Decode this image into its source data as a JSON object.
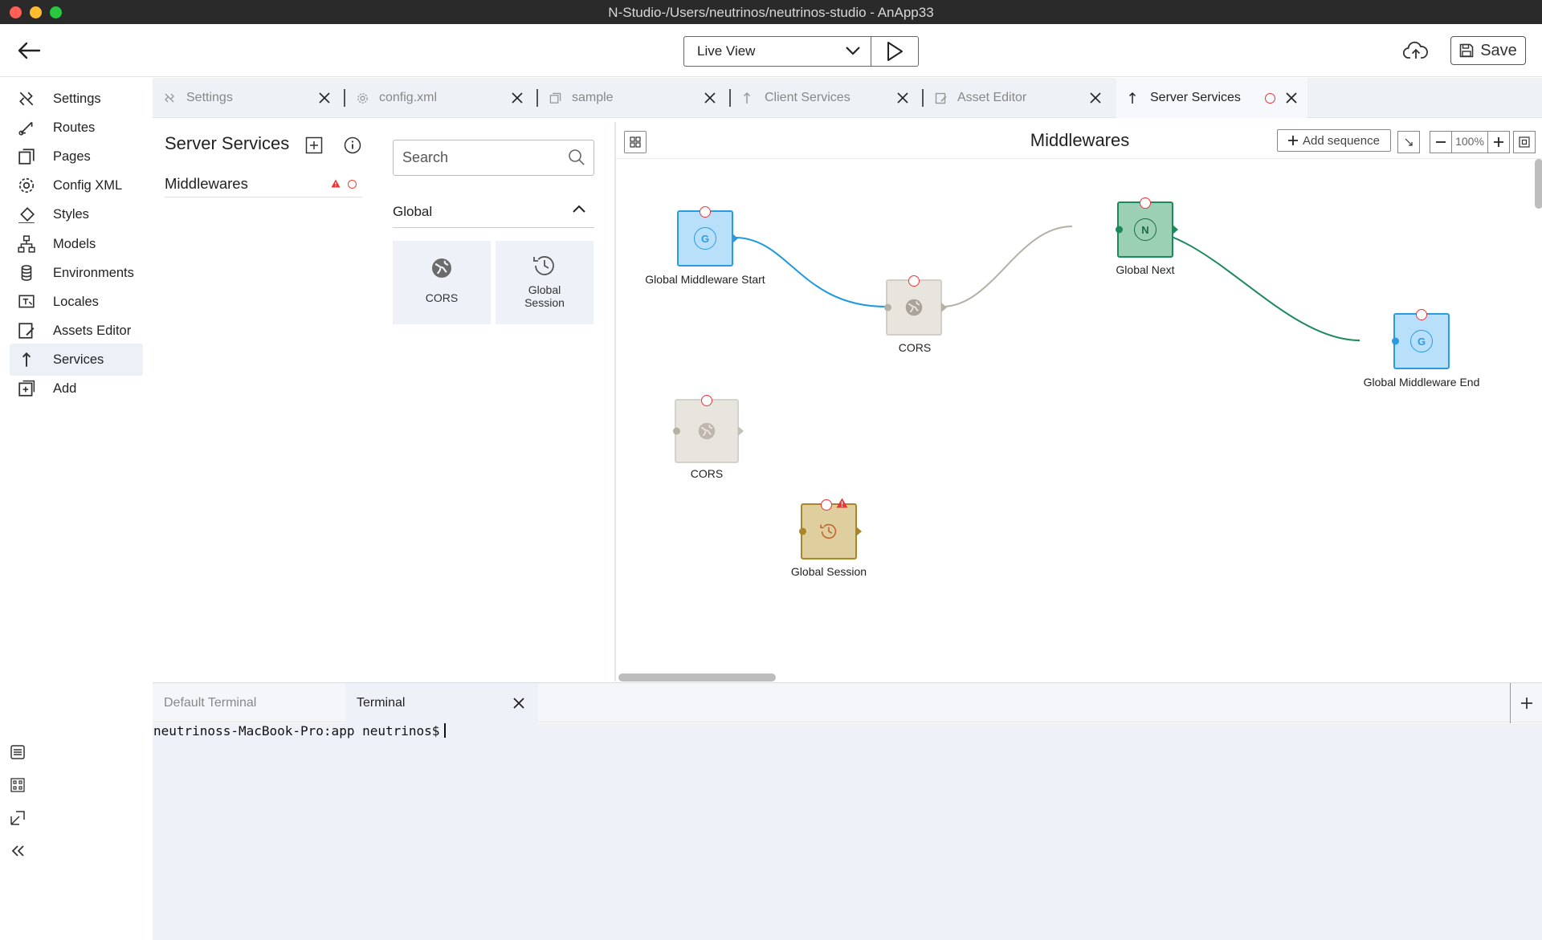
{
  "window": {
    "title": "N-Studio-/Users/neutrinos/neutrinos-studio - AnApp33"
  },
  "header": {
    "view_select": "Live View",
    "save_label": "Save"
  },
  "nav": {
    "items": [
      {
        "label": "Settings"
      },
      {
        "label": "Routes"
      },
      {
        "label": "Pages"
      },
      {
        "label": "Config XML"
      },
      {
        "label": "Styles"
      },
      {
        "label": "Models"
      },
      {
        "label": "Environments"
      },
      {
        "label": "Locales"
      },
      {
        "label": "Assets Editor"
      },
      {
        "label": "Services"
      },
      {
        "label": "Add"
      }
    ],
    "active": "Services"
  },
  "tabs": [
    {
      "label": "Settings"
    },
    {
      "label": "config.xml"
    },
    {
      "label": "sample"
    },
    {
      "label": "Client Services"
    },
    {
      "label": "Asset Editor"
    },
    {
      "label": "Server Services"
    }
  ],
  "server_services": {
    "title": "Server Services",
    "items": [
      {
        "label": "Middlewares"
      }
    ]
  },
  "palette": {
    "search_placeholder": "Search",
    "group_label": "Global",
    "cards": [
      {
        "label": "CORS"
      },
      {
        "label": "Global Session"
      }
    ]
  },
  "canvas": {
    "title": "Middlewares",
    "add_sequence_label": "Add sequence",
    "zoom": "100%",
    "nodes": [
      {
        "label": "Global Middleware Start",
        "glyph": "G"
      },
      {
        "label": "CORS"
      },
      {
        "label": "Global Next",
        "glyph": "N"
      },
      {
        "label": "Global Middleware End",
        "glyph": "G"
      },
      {
        "label": "CORS"
      },
      {
        "label": "Global Session"
      }
    ]
  },
  "terminal": {
    "tabs": [
      {
        "label": "Default Terminal"
      },
      {
        "label": "Terminal"
      }
    ],
    "prompt": "neutrinoss-MacBook-Pro:app neutrinos$"
  },
  "colors": {
    "accent": "#1e9ae0",
    "next_green": "#1a8a5c",
    "error": "#e33333",
    "session_gold": "#a8862a"
  }
}
